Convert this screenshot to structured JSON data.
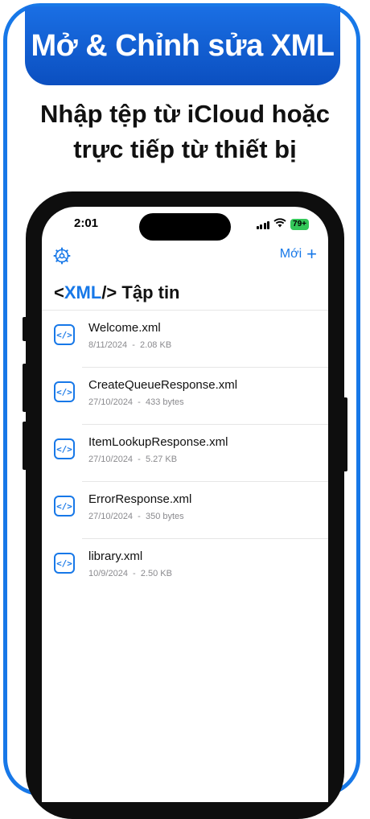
{
  "promo": {
    "banner_title": "Mở & Chỉnh sửa XML",
    "subtitle_line1": "Nhập tệp từ iCloud hoặc",
    "subtitle_line2": "trực tiếp từ thiết bị"
  },
  "status_bar": {
    "time": "2:01",
    "battery": "79+"
  },
  "nav": {
    "new_label": "Mới",
    "plus_icon": "+"
  },
  "page": {
    "title_open": "<",
    "title_xml": "XML",
    "title_close": "/>",
    "title_text": " Tập tin"
  },
  "icons": {
    "file_icon_text": "</>"
  },
  "files": [
    {
      "name": "Welcome.xml",
      "date": "8/11/2024",
      "size": "2.08 KB"
    },
    {
      "name": "CreateQueueResponse.xml",
      "date": "27/10/2024",
      "size": "433 bytes"
    },
    {
      "name": "ItemLookupResponse.xml",
      "date": "27/10/2024",
      "size": "5.27 KB"
    },
    {
      "name": "ErrorResponse.xml",
      "date": "27/10/2024",
      "size": "350 bytes"
    },
    {
      "name": "library.xml",
      "date": "10/9/2024",
      "size": "2.50 KB"
    }
  ],
  "meta_separator": "  -  ",
  "colors": {
    "accent": "#1778e8",
    "frame": "#1778e8",
    "battery": "#34c759"
  }
}
